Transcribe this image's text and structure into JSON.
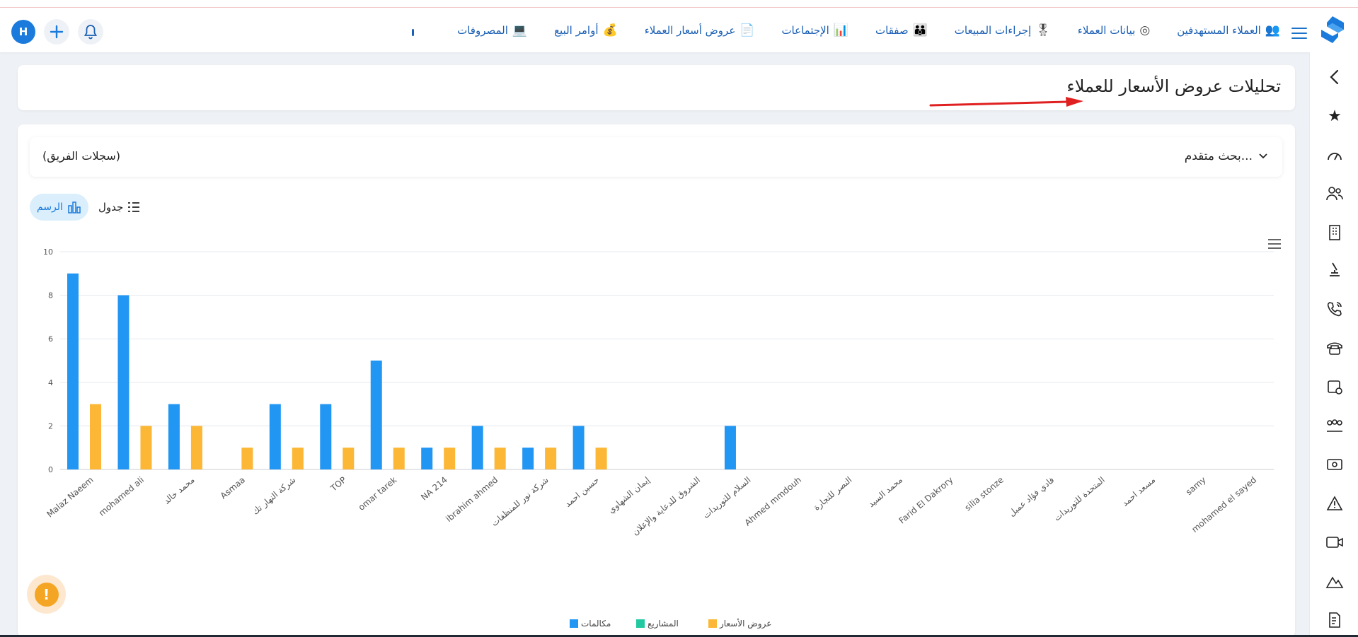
{
  "header": {
    "user_initial": "H",
    "nav": [
      {
        "label": "العملاء المستهدفين",
        "icon": "target-customers-icon"
      },
      {
        "label": "بيانات العملاء",
        "icon": "customer-data-icon"
      },
      {
        "label": "إجراءات المبيعات",
        "icon": "sales-actions-icon"
      },
      {
        "label": "صفقات",
        "icon": "deals-icon"
      },
      {
        "label": "الإجتماعات",
        "icon": "meetings-icon"
      },
      {
        "label": "عروض أسعار العملاء",
        "icon": "price-quotes-icon"
      },
      {
        "label": "أوامر البيع",
        "icon": "sales-orders-icon"
      },
      {
        "label": "المصروفات",
        "icon": "expenses-icon"
      }
    ]
  },
  "page": {
    "title": "تحليلات عروض الأسعار للعملاء"
  },
  "filter": {
    "advanced_search": "بحث متقدم...",
    "team_records": "(سجلات الفريق)"
  },
  "view_toggle": {
    "chart_label": "الرسم",
    "table_label": "جدول"
  },
  "chart_data": {
    "type": "bar",
    "categories": [
      "Malaz Naeem",
      "mohamed ali",
      "محمد خالد",
      "Asmaa",
      "شركة النهار تك",
      "TOP",
      "omar tarek",
      "NA 214",
      "ibrahim ahmed",
      "شركة نور للمنظفات",
      "حسين احمد",
      "إيمان الشهاوي",
      "الشروق للدعاية والإعلان",
      "السلام للتوريدات",
      "Ahmed mmdouh",
      "النصر للتجارة",
      "محمد السيد",
      "Farid El Dakrory",
      "silia stonze",
      "فادي فؤاد عميل",
      "المتحدة للتوريدات",
      "مسعد احمد",
      "samy",
      "mohamed el sayed"
    ],
    "series": [
      {
        "name": "مكالمات",
        "color": "#2196f3",
        "values": [
          9,
          8,
          3,
          0,
          3,
          3,
          5,
          1,
          2,
          1,
          2,
          0,
          0,
          2,
          0,
          0,
          0,
          0,
          0,
          0,
          0,
          0,
          0,
          0
        ]
      },
      {
        "name": "المشاريع",
        "color": "#22c9a0",
        "values": [
          0,
          0,
          0,
          0,
          0,
          0,
          0,
          0,
          0,
          0,
          0,
          0,
          0,
          0,
          0,
          0,
          0,
          0,
          0,
          0,
          0,
          0,
          0,
          0
        ]
      },
      {
        "name": "عروض الأسعار",
        "color": "#fbb735",
        "values": [
          3,
          2,
          2,
          1,
          1,
          1,
          1,
          1,
          1,
          1,
          1,
          0,
          0,
          0,
          0,
          0,
          0,
          0,
          0,
          0,
          0,
          0,
          0,
          0
        ]
      }
    ],
    "yticks": [
      "0",
      "2",
      "4",
      "6",
      "8",
      "10"
    ],
    "ylim": [
      0,
      10
    ],
    "grid": true,
    "legend": "bottom-center"
  }
}
